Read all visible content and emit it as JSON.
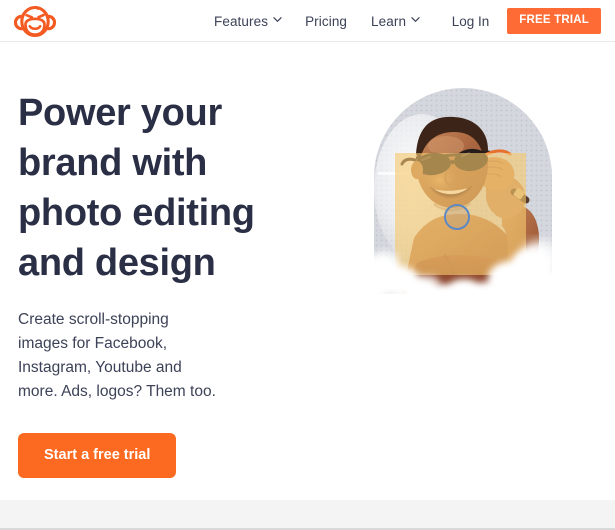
{
  "header": {
    "logo": {
      "icon": "picmonkey-monkey-logo",
      "color": "#f45a21"
    },
    "nav": [
      {
        "label": "Features",
        "has_dropdown": true,
        "caret": "chevron-down-icon"
      },
      {
        "label": "Pricing",
        "has_dropdown": false
      },
      {
        "label": "Learn",
        "has_dropdown": true,
        "caret": "chevron-down-icon"
      }
    ],
    "login_label": "Log In",
    "free_trial_label": "FREE TRIAL",
    "accent_color": "#ff6b35"
  },
  "hero": {
    "headline": "Power your brand with photo editing and design",
    "subcopy": "Create scroll-stopping images for Facebook, Instagram, Youtube and more. Ads, logos? Them too.",
    "cta_label": "Start a free trial",
    "cta_color": "#fb6a20",
    "headline_color": "#2b2f45",
    "art": {
      "description": "Smiling woman wearing sunglasses, arch-shaped dotted gray backdrop, translucent yellow overlay rectangle, blue selection circle and white cloud effects",
      "arch_color": "#d4d7dd",
      "overlay_color": "#f6c86e",
      "selection_circle_color": "#5c88c4"
    }
  },
  "footer": {
    "band_color": "#f4f4f5"
  }
}
